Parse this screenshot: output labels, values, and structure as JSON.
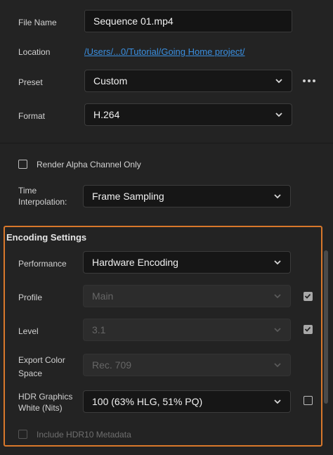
{
  "file_name": {
    "label": "File Name",
    "value": "Sequence 01.mp4"
  },
  "location": {
    "label": "Location",
    "value": "/Users/...0/Tutorial/Going Home project/"
  },
  "preset": {
    "label": "Preset",
    "value": "Custom"
  },
  "format": {
    "label": "Format",
    "value": "H.264"
  },
  "render_alpha": {
    "label": "Render Alpha Channel Only",
    "checked": false
  },
  "time_interpolation": {
    "label_line1": "Time",
    "label_line2": "Interpolation:",
    "value": "Frame Sampling"
  },
  "encoding": {
    "title": "Encoding Settings",
    "performance": {
      "label": "Performance",
      "value": "Hardware Encoding"
    },
    "profile": {
      "label": "Profile",
      "value": "Main",
      "checked": true
    },
    "level": {
      "label": "Level",
      "value": "3.1",
      "checked": true
    },
    "export_color_space": {
      "label_line1": "Export Color",
      "label_line2": "Space",
      "value": "Rec. 709"
    },
    "hdr_graphics_white": {
      "label_line1": "HDR Graphics",
      "label_line2": "White (Nits)",
      "value": "100 (63% HLG, 51% PQ)",
      "checked": false
    },
    "include_hdr10": {
      "label": "Include HDR10 Metadata",
      "checked": false
    }
  },
  "colors": {
    "accent_outline": "#d9782b",
    "link": "#3a8fe0",
    "background": "#232323"
  }
}
